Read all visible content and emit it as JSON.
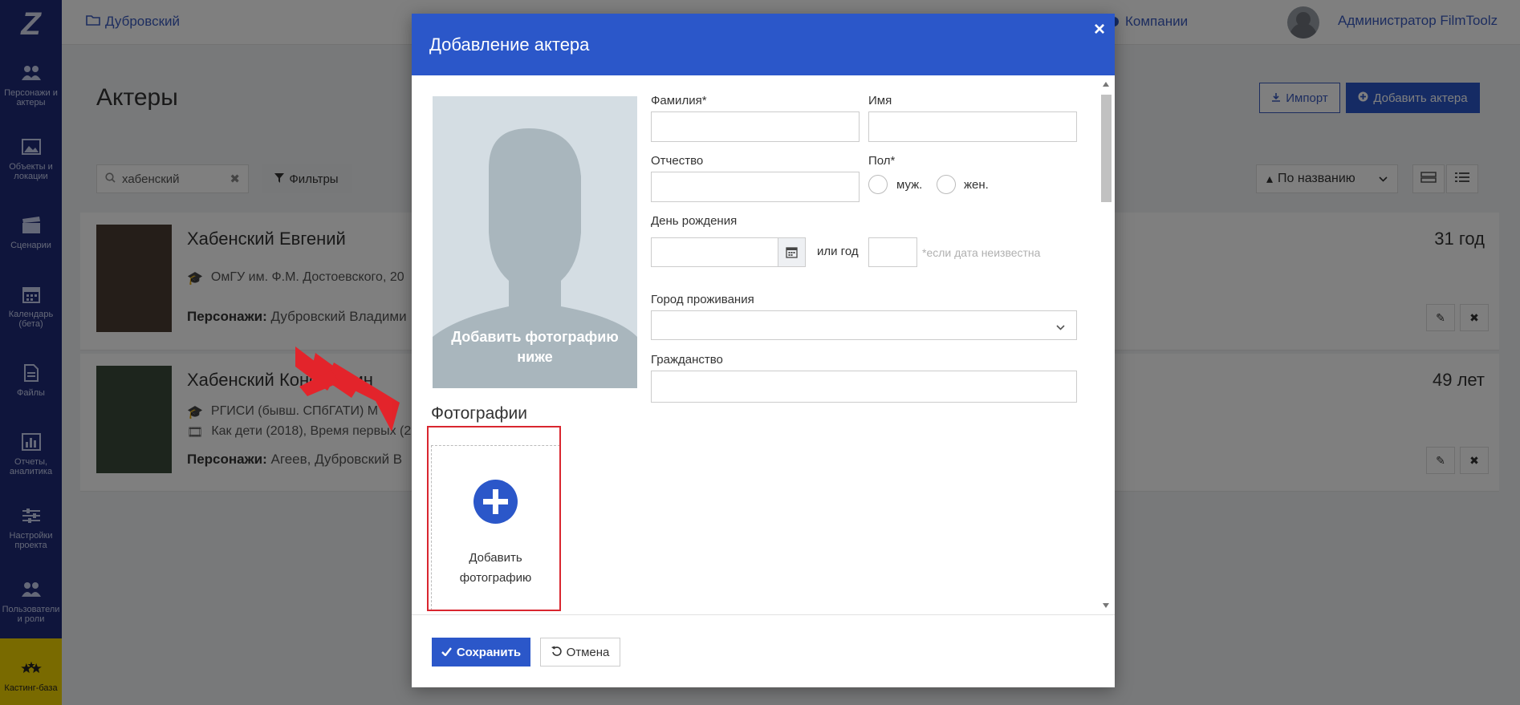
{
  "topbar": {
    "breadcrumb": "Дубровский",
    "companies": "Компании",
    "user_name": "Администратор FilmToolz"
  },
  "sidebar": {
    "logo": "Z",
    "items": [
      {
        "label": "Персонажи и актеры",
        "icon": "people-icon"
      },
      {
        "label": "Объекты и локации",
        "icon": "image-icon"
      },
      {
        "label": "Сценарии",
        "icon": "clapperboard-icon"
      },
      {
        "label": "Календарь (бета)",
        "icon": "calendar-icon"
      },
      {
        "label": "Файлы",
        "icon": "file-icon"
      },
      {
        "label": "Отчеты, аналитика",
        "icon": "bar-chart-icon"
      },
      {
        "label": "Настройки проекта",
        "icon": "sliders-icon"
      },
      {
        "label": "Пользователи и роли",
        "icon": "users-icon"
      },
      {
        "label": "Кастинг-база",
        "icon": "stars-icon"
      }
    ]
  },
  "page": {
    "title": "Актеры",
    "import_label": "Импорт",
    "add_actor_label": "Добавить актера",
    "search_value": "хабенский",
    "filters_label": "Фильтры",
    "sort_label": "По названию"
  },
  "actors": [
    {
      "name": "Хабенский Евгений",
      "age": "31 год",
      "education": "ОмГУ им. Ф.М. Достоевского, 20",
      "characters_label": "Персонажи:",
      "characters": "Дубровский Владими"
    },
    {
      "name": "Хабенский Константин",
      "age": "49 лет",
      "education": "РГИСИ (бывш. СПбГАТИ) М",
      "films": "Как дети (2018), Время первых (2",
      "characters_label": "Персонажи:",
      "characters": "Агеев,  Дубровский В"
    }
  ],
  "modal": {
    "title": "Добавление актера",
    "photo_caption": "Добавить фотографию ниже",
    "fields": {
      "last_name": "Фамилия",
      "first_name": "Имя",
      "middle_name": "Отчество",
      "gender": "Пол",
      "gender_male": "муж.",
      "gender_female": "жен.",
      "birthday": "День рождения",
      "or_year": "или год",
      "year_hint": "*если дата неизвестна",
      "city": "Город проживания",
      "citizenship": "Гражданство"
    },
    "required_mark": "*",
    "photos_section": "Фотографии",
    "add_photo_label": "Добавить фотографию",
    "save_label": "Сохранить",
    "cancel_label": "Отмена"
  },
  "colors": {
    "sidebar": "#1e2a78",
    "accent": "#2b57c9",
    "highlight": "#d9262f",
    "arrow": "#e3242b"
  }
}
